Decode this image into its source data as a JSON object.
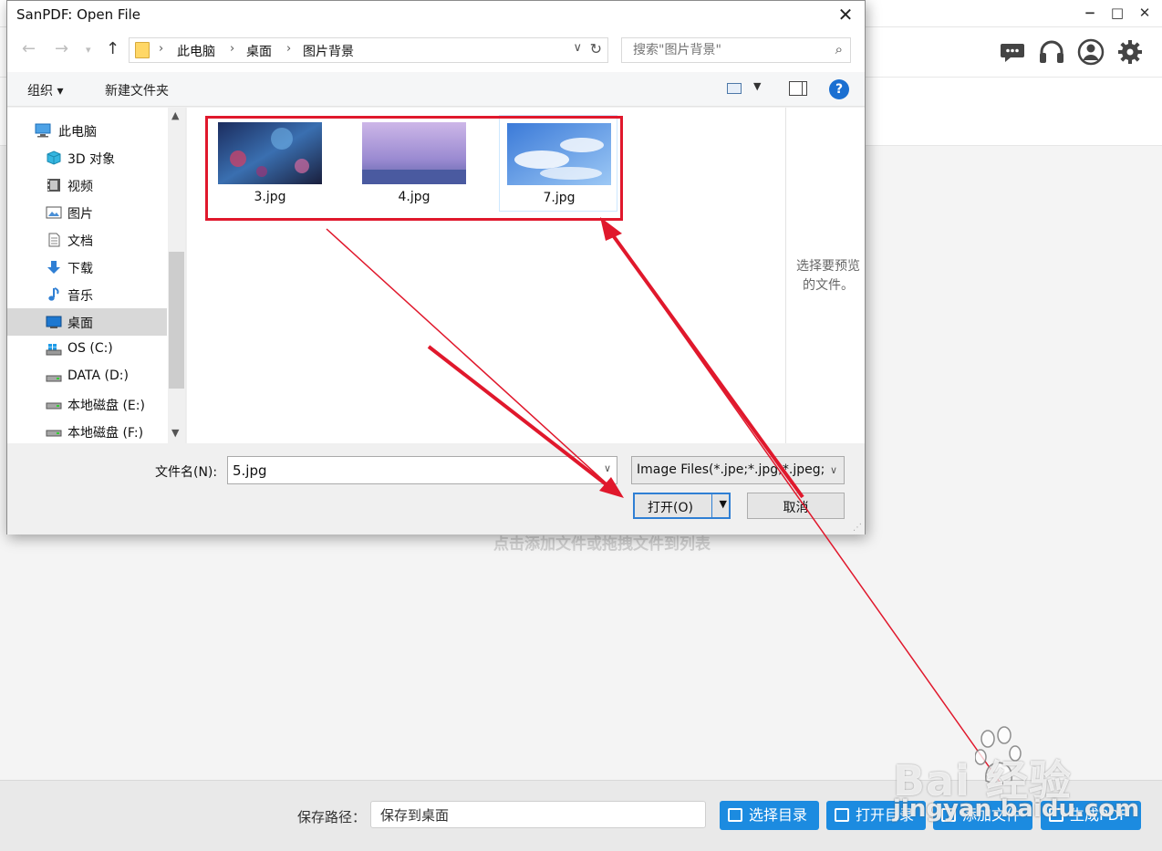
{
  "app": {
    "hint": "点击添加文件或拖拽文件到列表",
    "save_path_label": "保存路径：",
    "save_path_value": "保存到桌面",
    "buttons": [
      "选择目录",
      "打开目录",
      "添加文件",
      "生成PDF"
    ],
    "window_controls": [
      "−",
      "□",
      "✕"
    ],
    "toolbar_icons": [
      "chat-icon",
      "headset-icon",
      "user-icon",
      "settings-icon"
    ],
    "accent_color": "#1c8be0"
  },
  "dialog": {
    "title": "SanPDF: Open File",
    "breadcrumbs": [
      "此电脑",
      "桌面",
      "图片背景"
    ],
    "search_placeholder": "搜索\"图片背景\"",
    "organize_label": "组织 ▾",
    "new_folder_label": "新建文件夹",
    "sidebar": [
      {
        "label": "此电脑",
        "icon": "computer-icon"
      },
      {
        "label": "3D 对象",
        "icon": "cube-icon"
      },
      {
        "label": "视频",
        "icon": "video-icon"
      },
      {
        "label": "图片",
        "icon": "picture-icon"
      },
      {
        "label": "文档",
        "icon": "document-icon"
      },
      {
        "label": "下载",
        "icon": "download-icon"
      },
      {
        "label": "音乐",
        "icon": "music-icon"
      },
      {
        "label": "桌面",
        "icon": "desktop-icon",
        "selected": true
      },
      {
        "label": "OS (C:)",
        "icon": "drive-icon"
      },
      {
        "label": "DATA (D:)",
        "icon": "drive-icon"
      },
      {
        "label": "本地磁盘 (E:)",
        "icon": "drive-icon"
      },
      {
        "label": "本地磁盘 (F:)",
        "icon": "drive-icon"
      }
    ],
    "files": [
      {
        "name": "3.jpg"
      },
      {
        "name": "4.jpg"
      },
      {
        "name": "7.jpg",
        "selected": true
      }
    ],
    "preview_text": "选择要预览的文件。",
    "filename_label": "文件名(N):",
    "filename_value": "5.jpg",
    "filter_value": "Image Files(*.jpe;*.jpg;*.jpeg;",
    "open_label": "打开(O)",
    "cancel_label": "取消"
  },
  "watermark": {
    "brand": "Bai 经验",
    "url": "jingyan.baidu.com"
  }
}
